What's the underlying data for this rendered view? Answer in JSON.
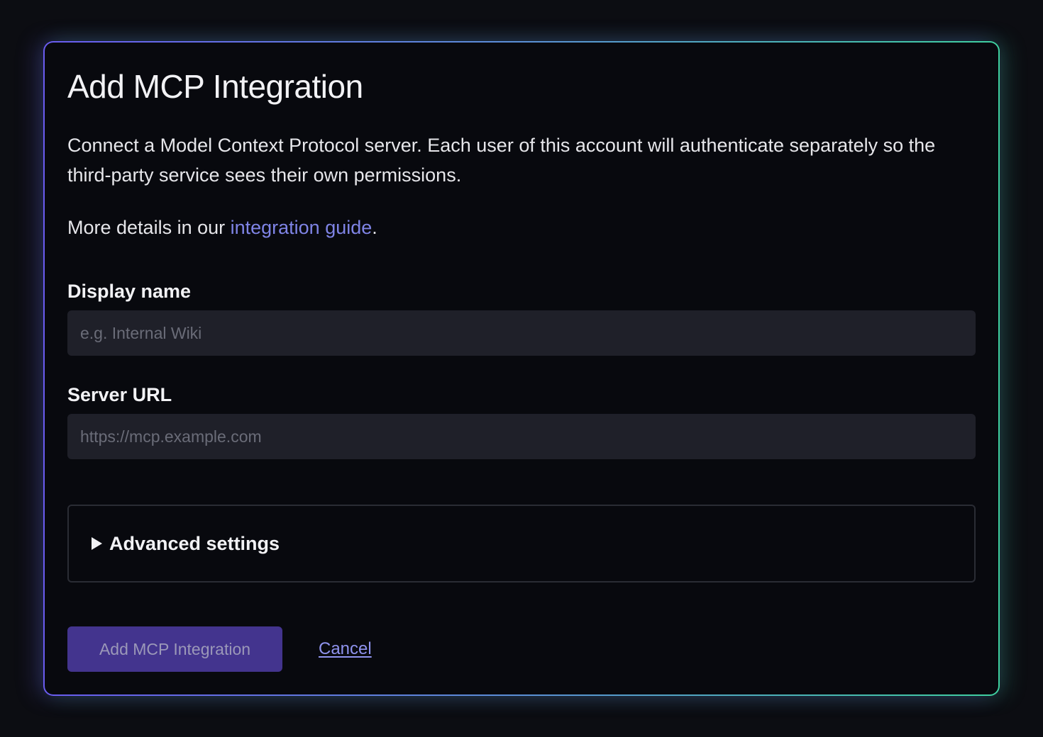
{
  "dialog": {
    "title": "Add MCP Integration",
    "description": "Connect a Model Context Protocol server. Each user of this account will authenticate separately so the third-party service sees their own permissions.",
    "more_prefix": "More details in our ",
    "more_link": "integration guide",
    "more_suffix": "."
  },
  "form": {
    "display_name": {
      "label": "Display name",
      "value": "",
      "placeholder": "e.g. Internal Wiki"
    },
    "server_url": {
      "label": "Server URL",
      "value": "",
      "placeholder": "https://mcp.example.com"
    },
    "advanced": {
      "label": "Advanced settings",
      "expanded": false
    }
  },
  "actions": {
    "submit_label": "Add MCP Integration",
    "cancel_label": "Cancel"
  },
  "colors": {
    "accent": "#7f84e6",
    "primary_button": "#43348e",
    "background": "#08090e",
    "border_gradient_start": "#6a5cf0",
    "border_gradient_end": "#3fd0a0"
  },
  "icons": {
    "advanced_toggle": "triangle-right-icon"
  }
}
